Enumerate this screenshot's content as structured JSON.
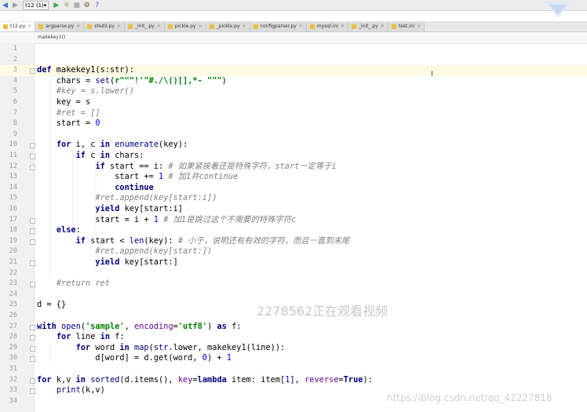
{
  "toolbar": {
    "run_config": "t12 (1)",
    "items": [
      {
        "name": "back-icon",
        "glyph": "◀"
      },
      {
        "name": "forward-icon",
        "glyph": "▶"
      },
      {
        "name": "run-icon",
        "glyph": "▶"
      },
      {
        "name": "debug-icon",
        "glyph": "☼"
      },
      {
        "name": "stop-icon",
        "glyph": "■"
      },
      {
        "name": "settings-icon",
        "glyph": "⚙"
      },
      {
        "name": "help-icon",
        "glyph": "?"
      }
    ]
  },
  "tabs": [
    {
      "label": "t12.py",
      "active": true
    },
    {
      "label": "argparse.py"
    },
    {
      "label": "shutil.py"
    },
    {
      "label": "_init_.py"
    },
    {
      "label": "pickle.py"
    },
    {
      "label": "_pickle.py"
    },
    {
      "label": "configparser.py"
    },
    {
      "label": "mysql.ini"
    },
    {
      "label": "_init_.py"
    },
    {
      "label": "test.ini"
    }
  ],
  "breadcrumb": "makekey1()",
  "colors": {
    "keyword": "#000080",
    "string": "#008000",
    "number": "#0000ff",
    "comment": "#808080",
    "current_line": "#fffae3"
  },
  "lines": [
    {
      "n": "1",
      "tokens": []
    },
    {
      "n": "2",
      "tokens": []
    },
    {
      "n": "3",
      "current": true,
      "fold": true,
      "tokens": [
        {
          "t": "def",
          "c": "kw"
        },
        {
          "t": " makekey1(s:str):"
        }
      ]
    },
    {
      "n": "4",
      "tokens": [
        {
          "t": "    chars = "
        },
        {
          "t": "set",
          "c": "bi"
        },
        {
          "t": "("
        },
        {
          "t": "r\"\"\"!'\"#./\\()[],*- \"\"\"",
          "c": "str"
        },
        {
          "t": ")"
        }
      ]
    },
    {
      "n": "5",
      "tokens": [
        {
          "t": "    "
        },
        {
          "t": "#key = s.lower()",
          "c": "cmt"
        }
      ]
    },
    {
      "n": "6",
      "tokens": [
        {
          "t": "    key = s"
        }
      ]
    },
    {
      "n": "7",
      "tokens": [
        {
          "t": "    "
        },
        {
          "t": "#ret = []",
          "c": "cmt"
        }
      ]
    },
    {
      "n": "8",
      "tokens": [
        {
          "t": "    start = "
        },
        {
          "t": "0",
          "c": "num"
        }
      ]
    },
    {
      "n": "9",
      "tokens": []
    },
    {
      "n": "10",
      "fold": true,
      "tokens": [
        {
          "t": "    "
        },
        {
          "t": "for",
          "c": "kw"
        },
        {
          "t": " i, c "
        },
        {
          "t": "in",
          "c": "kw"
        },
        {
          "t": " "
        },
        {
          "t": "enumerate",
          "c": "bi"
        },
        {
          "t": "(key):"
        }
      ]
    },
    {
      "n": "11",
      "fold": true,
      "tokens": [
        {
          "t": "        "
        },
        {
          "t": "if",
          "c": "kw"
        },
        {
          "t": " c "
        },
        {
          "t": "in",
          "c": "kw"
        },
        {
          "t": " chars:"
        }
      ]
    },
    {
      "n": "12",
      "fold": true,
      "tokens": [
        {
          "t": "            "
        },
        {
          "t": "if",
          "c": "kw"
        },
        {
          "t": " start == i: "
        },
        {
          "t": "# 如果紧挨着还是特殊字符，start一定等于i",
          "c": "cmt"
        }
      ]
    },
    {
      "n": "13",
      "tokens": [
        {
          "t": "                start += "
        },
        {
          "t": "1",
          "c": "num"
        },
        {
          "t": " "
        },
        {
          "t": "# 加1并continue",
          "c": "cmt"
        }
      ]
    },
    {
      "n": "14",
      "tokens": [
        {
          "t": "                "
        },
        {
          "t": "continue",
          "c": "kw"
        }
      ]
    },
    {
      "n": "15",
      "tokens": [
        {
          "t": "            "
        },
        {
          "t": "#ret.append(key[start:i])",
          "c": "cmt"
        }
      ]
    },
    {
      "n": "16",
      "tokens": [
        {
          "t": "            "
        },
        {
          "t": "yield",
          "c": "kw"
        },
        {
          "t": " key[start:i]"
        }
      ]
    },
    {
      "n": "17",
      "fold": true,
      "tokens": [
        {
          "t": "            start = i + "
        },
        {
          "t": "1",
          "c": "num"
        },
        {
          "t": " "
        },
        {
          "t": "# 加1是跳过这个不需要的特殊字符c",
          "c": "cmt"
        }
      ]
    },
    {
      "n": "18",
      "fold": true,
      "tokens": [
        {
          "t": "    "
        },
        {
          "t": "else",
          "c": "kw"
        },
        {
          "t": ":"
        }
      ]
    },
    {
      "n": "19",
      "fold": true,
      "tokens": [
        {
          "t": "        "
        },
        {
          "t": "if",
          "c": "kw"
        },
        {
          "t": " start < "
        },
        {
          "t": "len",
          "c": "bi"
        },
        {
          "t": "(key): "
        },
        {
          "t": "# 小于，说明还有有效的字符，而且一直到末尾",
          "c": "cmt"
        }
      ]
    },
    {
      "n": "20",
      "tokens": [
        {
          "t": "            "
        },
        {
          "t": "#ret.append(key[start:])",
          "c": "cmt"
        }
      ]
    },
    {
      "n": "21",
      "fold": true,
      "tokens": [
        {
          "t": "            "
        },
        {
          "t": "yield",
          "c": "kw"
        },
        {
          "t": " key[start:]"
        }
      ]
    },
    {
      "n": "22",
      "tokens": []
    },
    {
      "n": "23",
      "fold": true,
      "tokens": [
        {
          "t": "    "
        },
        {
          "t": "#return ret",
          "c": "cmt"
        }
      ]
    },
    {
      "n": "24",
      "tokens": []
    },
    {
      "n": "25",
      "tokens": [
        {
          "t": "d = {}"
        }
      ]
    },
    {
      "n": "26",
      "tokens": []
    },
    {
      "n": "27",
      "fold": true,
      "tokens": [
        {
          "t": "with",
          "c": "kw"
        },
        {
          "t": " "
        },
        {
          "t": "open",
          "c": "bi"
        },
        {
          "t": "("
        },
        {
          "t": "'sample'",
          "c": "str"
        },
        {
          "t": ", "
        },
        {
          "t": "encoding",
          "c": "kwarg"
        },
        {
          "t": "="
        },
        {
          "t": "'utf8'",
          "c": "str"
        },
        {
          "t": ") "
        },
        {
          "t": "as",
          "c": "kw"
        },
        {
          "t": " f:"
        }
      ]
    },
    {
      "n": "28",
      "fold": true,
      "tokens": [
        {
          "t": "    "
        },
        {
          "t": "for",
          "c": "kw"
        },
        {
          "t": " line "
        },
        {
          "t": "in",
          "c": "kw"
        },
        {
          "t": " f:"
        }
      ]
    },
    {
      "n": "29",
      "fold": true,
      "tokens": [
        {
          "t": "        "
        },
        {
          "t": "for",
          "c": "kw"
        },
        {
          "t": " word "
        },
        {
          "t": "in",
          "c": "kw"
        },
        {
          "t": " "
        },
        {
          "t": "map",
          "c": "bi"
        },
        {
          "t": "("
        },
        {
          "t": "str",
          "c": "bi"
        },
        {
          "t": ".lower, makekey1(line)):"
        }
      ]
    },
    {
      "n": "30",
      "fold": true,
      "tokens": [
        {
          "t": "            d[word] = d.get(word, "
        },
        {
          "t": "0",
          "c": "num"
        },
        {
          "t": ") + "
        },
        {
          "t": "1",
          "c": "num"
        }
      ]
    },
    {
      "n": "31",
      "tokens": []
    },
    {
      "n": "32",
      "fold": true,
      "tokens": [
        {
          "t": "for",
          "c": "kw"
        },
        {
          "t": " k,v "
        },
        {
          "t": "in",
          "c": "kw"
        },
        {
          "t": " "
        },
        {
          "t": "sorted",
          "c": "bi"
        },
        {
          "t": "(d.items(), "
        },
        {
          "t": "key",
          "c": "kwarg"
        },
        {
          "t": "="
        },
        {
          "t": "lambda",
          "c": "kw"
        },
        {
          "t": " item: item["
        },
        {
          "t": "1",
          "c": "num"
        },
        {
          "t": "], "
        },
        {
          "t": "reverse",
          "c": "kwarg"
        },
        {
          "t": "="
        },
        {
          "t": "True",
          "c": "kw"
        },
        {
          "t": "):"
        }
      ]
    },
    {
      "n": "33",
      "fold": true,
      "tokens": [
        {
          "t": "    "
        },
        {
          "t": "print",
          "c": "bi"
        },
        {
          "t": "(k,v)"
        }
      ]
    },
    {
      "n": "34",
      "tokens": []
    }
  ],
  "overlay_text": "2278562正在观看视频",
  "watermark": "https://blog.csdn.net/qq_42227818"
}
